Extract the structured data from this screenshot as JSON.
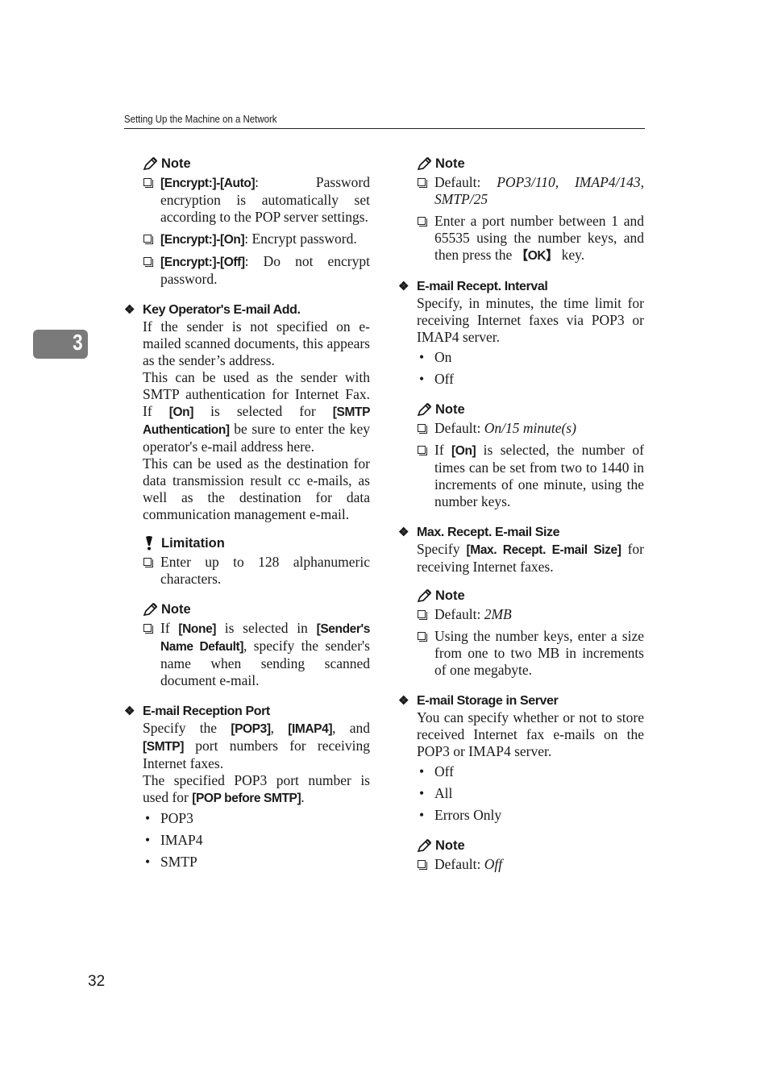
{
  "header": {
    "running_title": "Setting Up the Machine on a Network"
  },
  "chapter_tab": "3",
  "page_number": "32",
  "left_column": {
    "note1": {
      "heading": "Note",
      "items": [
        {
          "bold": "[Encrypt:]-[Auto]",
          "text": ": Password encryption is automatically set according to the POP server settings."
        },
        {
          "bold": "[Encrypt:]-[On]",
          "text": ": Encrypt password."
        },
        {
          "bold": "[Encrypt:]-[Off]",
          "text": ": Do not encrypt password."
        }
      ]
    },
    "key_operator": {
      "heading": "Key Operator's E-mail Add.",
      "p1": "If the sender is not specified on e-mailed scanned documents, this appears as the sender’s address.",
      "p2_a": "This can be used as the sender with SMTP authentication for Internet Fax. If ",
      "p2_b1": "[On]",
      "p2_c": " is selected for ",
      "p2_b2": "[SMTP Authentication]",
      "p2_d": " be sure to enter the key operator's e-mail address here.",
      "p3": "This can be used as the destination for data transmission result cc e-mails, as well as the destination for data communication management e-mail."
    },
    "limitation": {
      "heading": "Limitation",
      "items": [
        {
          "text": "Enter up to 128 alphanumeric characters."
        }
      ]
    },
    "note2": {
      "heading": "Note",
      "item": {
        "a": "If ",
        "b1": "[None]",
        "c": " is selected in ",
        "b2": "[Sender's Name Default]",
        "d": ", specify the sender's name when sending scanned document e-mail."
      }
    },
    "reception_port": {
      "heading": "E-mail Reception Port",
      "p1_a": "Specify the ",
      "p1_b1": "[POP3]",
      "p1_c": ", ",
      "p1_b2": "[IMAP4]",
      "p1_d": ", and ",
      "p1_b3": "[SMTP]",
      "p1_e": " port numbers for receiving Internet faxes.",
      "p2_a": "The specified POP3 port number is used for ",
      "p2_b": "[POP before SMTP]",
      "p2_c": ".",
      "options": [
        "POP3",
        "IMAP4",
        "SMTP"
      ]
    }
  },
  "right_column": {
    "note1": {
      "heading": "Note",
      "default_label": "Default: ",
      "default_value": "POP3/110, IMAP4/143, SMTP/25",
      "item2_a": "Enter a port number between 1 and 65535 using the number keys, and then press the ",
      "item2_key": "【OK】",
      "item2_b": " key."
    },
    "recept_interval": {
      "heading": "E-mail Recept. Interval",
      "body": "Specify, in minutes, the time limit for receiving Internet faxes via POP3 or IMAP4 server.",
      "options": [
        "On",
        "Off"
      ]
    },
    "note2": {
      "heading": "Note",
      "default_label": "Default: ",
      "default_value": "On/15 minute(s)",
      "item2_a": "If ",
      "item2_b": "[On]",
      "item2_c": " is selected, the number of times can be set from two to 1440 in increments of one minute, using the number keys."
    },
    "max_size": {
      "heading": "Max. Recept. E-mail Size",
      "body_a": "Specify ",
      "body_b": "[Max. Recept. E-mail Size]",
      "body_c": " for receiving Internet faxes."
    },
    "note3": {
      "heading": "Note",
      "default_label": "Default: ",
      "default_value": "2MB",
      "item2": "Using the number keys, enter a size from one to two MB in increments of one megabyte."
    },
    "storage": {
      "heading": "E-mail Storage in Server",
      "body": "You can specify whether or not to store received Internet fax e-mails on the POP3 or IMAP4 server.",
      "options": [
        "Off",
        "All",
        "Errors Only"
      ]
    },
    "note4": {
      "heading": "Note",
      "default_label": "Default: ",
      "default_value": "Off"
    }
  }
}
